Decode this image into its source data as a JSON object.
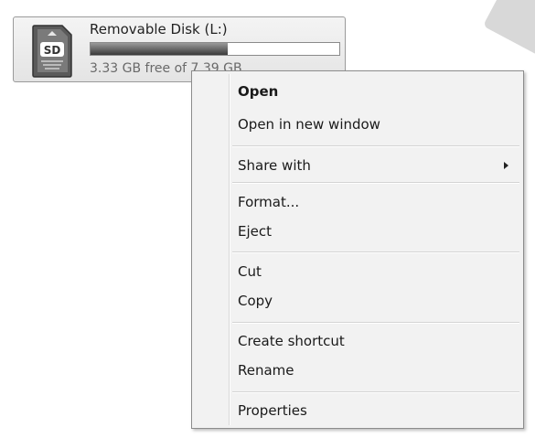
{
  "drive": {
    "name": "Removable Disk (L:)",
    "free_text": "3.33 GB free of 7.39 GB",
    "used_fraction": 0.55,
    "icon": "sd-card-icon",
    "icon_text": "SD"
  },
  "menu": {
    "open": "Open",
    "open_new_window": "Open in new window",
    "share_with": "Share with",
    "format": "Format...",
    "eject": "Eject",
    "cut": "Cut",
    "copy": "Copy",
    "create_shortcut": "Create shortcut",
    "rename": "Rename",
    "properties": "Properties"
  }
}
